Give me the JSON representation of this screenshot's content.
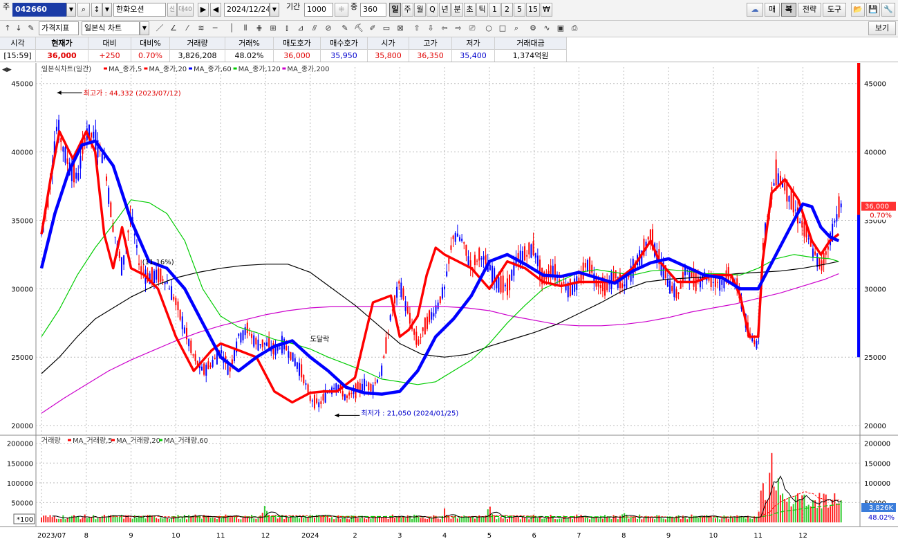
{
  "toolbar1": {
    "market_label": "주",
    "stock_code": "042660",
    "stock_name": "한화오션",
    "badge_credit": "신",
    "badge_margin": "대40",
    "date": "2024/12/24",
    "period_label": "기간",
    "period_value": "1000",
    "overlap_label": "중",
    "overlap_value": "360",
    "intervals": [
      "일",
      "주",
      "월",
      "Q",
      "년",
      "분",
      "초",
      "틱",
      "1",
      "2",
      "5",
      "15",
      "₩"
    ],
    "active_interval": "일",
    "right_buttons": [
      "매",
      "복",
      "전략",
      "도구"
    ]
  },
  "toolbar2": {
    "price_indicator": "가격지표",
    "chart_type": "일본식 차트",
    "view_button": "보기"
  },
  "quote": {
    "headers": [
      "시각",
      "현재가",
      "대비",
      "대비%",
      "거래량",
      "거래%",
      "매도호가",
      "매수호가",
      "시가",
      "고가",
      "저가",
      "거래대금"
    ],
    "values": [
      "[15:59]",
      "36,000",
      "+250",
      "0.70%",
      "3,826,208",
      "48.02%",
      "36,000",
      "35,950",
      "35,800",
      "36,350",
      "35,400",
      "1,374억원"
    ]
  },
  "chart_data": [
    {
      "type": "candlestick",
      "legend_title": "일본식차트(일간)",
      "legend": [
        {
          "name": "MA_종가,5",
          "color": "#ff0000"
        },
        {
          "name": "MA_종가,20",
          "color": "#ff0000"
        },
        {
          "name": "MA_종가,60",
          "color": "#0000ff"
        },
        {
          "name": "MA_종가,120",
          "color": "#00cc00"
        },
        {
          "name": "MA_종가,200",
          "color": "#cc00cc"
        }
      ],
      "y_ticks": [
        20000,
        25000,
        30000,
        35000,
        40000,
        45000
      ],
      "y_tick_labels": [
        "20000",
        "25000",
        "30000",
        "35000",
        "40000",
        "45000"
      ],
      "ylim": [
        19500,
        46200
      ],
      "x_ticks": [
        {
          "label": "2023/07",
          "month": 0
        },
        {
          "label": "8",
          "month": 1
        },
        {
          "label": "9",
          "month": 2
        },
        {
          "label": "10",
          "month": 3
        },
        {
          "label": "11",
          "month": 4
        },
        {
          "label": "12",
          "month": 5
        },
        {
          "label": "2024",
          "month": 6
        },
        {
          "label": "2",
          "month": 7
        },
        {
          "label": "3",
          "month": 8
        },
        {
          "label": "4",
          "month": 9
        },
        {
          "label": "5",
          "month": 10
        },
        {
          "label": "6",
          "month": 11
        },
        {
          "label": "7",
          "month": 12
        },
        {
          "label": "8",
          "month": 13
        },
        {
          "label": "9",
          "month": 14
        },
        {
          "label": "10",
          "month": 15
        },
        {
          "label": "11",
          "month": 16
        },
        {
          "label": "12",
          "month": 17
        }
      ],
      "max_annotation": "최고가 : 44,332 (2023/07/12)",
      "min_annotation": "최저가 : 21,050 (2024/01/25)",
      "mid_annotation_1": "(11.16%)",
      "mid_annotation_2": "도달락",
      "current_price_label": "36,000",
      "current_change_label": "0.70%",
      "close_series": {
        "month": [
          0.0,
          0.15,
          0.35,
          0.55,
          0.8,
          1.0,
          1.2,
          1.4,
          1.6,
          1.8,
          2.0,
          2.2,
          2.4,
          2.6,
          2.8,
          3.0,
          3.2,
          3.4,
          3.6,
          3.8,
          4.0,
          4.2,
          4.4,
          4.6,
          4.8,
          5.0,
          5.2,
          5.4,
          5.6,
          5.8,
          6.0,
          6.2,
          6.4,
          6.6,
          6.8,
          7.0,
          7.2,
          7.4,
          7.6,
          7.8,
          8.0,
          8.2,
          8.4,
          8.6,
          8.8,
          9.0,
          9.2,
          9.4,
          9.6,
          9.8,
          10.0,
          10.2,
          10.4,
          10.6,
          10.8,
          11.0,
          11.2,
          11.4,
          11.6,
          11.8,
          12.0,
          12.2,
          12.4,
          12.6,
          12.8,
          13.0,
          13.2,
          13.4,
          13.6,
          13.8,
          14.0,
          14.2,
          14.4,
          14.6,
          14.8,
          15.0,
          15.2,
          15.4,
          15.6,
          15.8,
          16.0,
          16.1,
          16.2,
          16.4,
          16.6,
          16.8,
          17.0,
          17.2,
          17.4,
          17.6,
          17.8
        ],
        "value": [
          34000,
          36500,
          42000,
          39500,
          38000,
          41500,
          41000,
          39500,
          34500,
          31500,
          35500,
          31500,
          30800,
          31000,
          30500,
          29000,
          27000,
          25000,
          24000,
          24500,
          25500,
          24000,
          26500,
          27000,
          26000,
          26000,
          25500,
          26000,
          25000,
          24000,
          22000,
          21500,
          22500,
          23000,
          22000,
          22500,
          23000,
          22800,
          24000,
          28000,
          30500,
          28000,
          26000,
          27500,
          28500,
          30000,
          34000,
          33500,
          31500,
          32500,
          31500,
          30500,
          30000,
          32000,
          32500,
          33000,
          30500,
          31500,
          30500,
          30000,
          30500,
          32000,
          30500,
          30000,
          31000,
          30000,
          31500,
          32500,
          34000,
          32000,
          30500,
          29500,
          31500,
          30500,
          31000,
          30500,
          30500,
          31000,
          29500,
          26500,
          26000,
          33000,
          35000,
          38500,
          37500,
          36000,
          34500,
          33000,
          31500,
          33500,
          36000
        ]
      },
      "ma5": {
        "month": [
          0.0,
          0.2,
          0.4,
          0.7,
          1.0,
          1.2,
          1.4,
          1.6,
          1.8,
          2.0,
          2.3,
          2.6,
          3.0,
          3.4,
          3.8,
          4.0,
          4.4,
          4.8,
          5.2,
          5.6,
          6.0,
          6.3,
          6.6,
          7.0,
          7.4,
          7.8,
          8.0,
          8.2,
          8.4,
          8.6,
          8.8,
          9.0,
          9.3,
          9.6,
          10.0,
          10.4,
          10.8,
          11.2,
          11.6,
          12.0,
          12.4,
          12.8,
          13.2,
          13.6,
          13.8,
          14.2,
          14.6,
          15.0,
          15.4,
          15.6,
          15.8,
          16.0,
          16.1,
          16.3,
          16.6,
          16.9,
          17.2,
          17.4,
          17.6,
          17.8
        ],
        "value": [
          34000,
          38000,
          41500,
          39500,
          41500,
          40000,
          34000,
          31500,
          34500,
          31500,
          31000,
          30000,
          26500,
          24000,
          25500,
          26000,
          25500,
          25000,
          22500,
          21700,
          22400,
          22500,
          22500,
          23500,
          29000,
          29500,
          26500,
          27000,
          28000,
          31000,
          33000,
          32500,
          32000,
          31500,
          30000,
          32000,
          31500,
          30500,
          30200,
          30500,
          30500,
          30500,
          31500,
          33500,
          32000,
          30500,
          30500,
          31000,
          31000,
          29500,
          26500,
          26500,
          32000,
          37000,
          38000,
          36500,
          33500,
          32500,
          33500,
          34000
        ]
      },
      "ma60": {
        "month": [
          0.0,
          0.3,
          0.6,
          0.9,
          1.2,
          1.6,
          2.0,
          2.4,
          2.8,
          3.2,
          3.6,
          4.0,
          4.4,
          4.8,
          5.2,
          5.6,
          6.0,
          6.4,
          6.8,
          7.2,
          7.6,
          8.0,
          8.4,
          8.8,
          9.2,
          9.6,
          10.0,
          10.4,
          10.8,
          11.2,
          11.6,
          12.0,
          12.4,
          12.8,
          13.2,
          13.6,
          14.0,
          14.4,
          14.8,
          15.2,
          15.6,
          16.0,
          16.4,
          16.8,
          17.0,
          17.2,
          17.4,
          17.6,
          17.8
        ],
        "value": [
          31500,
          35500,
          38500,
          40500,
          40800,
          39000,
          35000,
          32000,
          31500,
          30000,
          27500,
          25000,
          24000,
          25000,
          25800,
          26200,
          25000,
          24000,
          22800,
          22400,
          22300,
          22500,
          24000,
          26500,
          27800,
          29500,
          32000,
          32500,
          31800,
          31000,
          30900,
          31200,
          30800,
          30400,
          31300,
          31900,
          32200,
          31600,
          31000,
          30800,
          30000,
          30000,
          32500,
          35000,
          36200,
          36000,
          34500,
          33800,
          33500
        ]
      },
      "ma120": {
        "month": [
          0.0,
          0.4,
          0.8,
          1.2,
          1.6,
          2.0,
          2.4,
          2.8,
          3.2,
          3.6,
          4.0,
          4.4,
          4.8,
          5.2,
          5.6,
          6.0,
          6.4,
          6.8,
          7.2,
          7.6,
          8.0,
          8.4,
          8.8,
          9.2,
          9.6,
          10.0,
          10.4,
          10.8,
          11.2,
          11.6,
          12.0,
          12.4,
          12.8,
          13.2,
          13.6,
          14.0,
          14.4,
          14.8,
          15.2,
          15.6,
          16.0,
          16.4,
          16.8,
          17.2,
          17.6,
          17.8
        ],
        "value": [
          26500,
          28500,
          31000,
          33000,
          34700,
          36500,
          36300,
          35500,
          33500,
          30000,
          28000,
          27200,
          26800,
          26300,
          26000,
          25600,
          25000,
          24500,
          24000,
          23400,
          23200,
          23000,
          23200,
          24000,
          24800,
          26000,
          27500,
          28800,
          30000,
          30600,
          31200,
          31400,
          31200,
          31000,
          31300,
          31400,
          31300,
          31100,
          31100,
          31000,
          31500,
          32200,
          32500,
          32300,
          32200,
          32000
        ]
      },
      "ma200": {
        "month": [
          0.0,
          0.4,
          0.8,
          1.2,
          1.6,
          2.0,
          2.5,
          3.0,
          3.5,
          4.0,
          4.5,
          5.0,
          5.5,
          6.0,
          6.5,
          7.0,
          7.5,
          8.0,
          8.5,
          9.0,
          9.5,
          10.0,
          10.5,
          11.0,
          11.5,
          12.0,
          12.5,
          13.0,
          13.5,
          14.0,
          14.5,
          15.0,
          15.5,
          16.0,
          16.5,
          17.0,
          17.5,
          17.8
        ],
        "value": [
          23800,
          25000,
          26500,
          27800,
          28600,
          29400,
          30200,
          30800,
          31200,
          31500,
          31700,
          31800,
          31800,
          31200,
          30000,
          28800,
          27400,
          26000,
          25200,
          25000,
          25200,
          25800,
          26300,
          26800,
          27400,
          28200,
          29000,
          29900,
          30500,
          30700,
          30800,
          30900,
          31100,
          31200,
          31300,
          31500,
          31800,
          32000
        ]
      },
      "ma_magenta": {
        "month": [
          0.0,
          0.5,
          1.0,
          1.5,
          2.0,
          2.5,
          3.0,
          3.5,
          4.0,
          4.5,
          5.0,
          5.5,
          6.0,
          6.5,
          7.0,
          7.5,
          8.0,
          8.5,
          9.0,
          9.5,
          10.0,
          10.5,
          11.0,
          11.5,
          12.0,
          12.5,
          13.0,
          13.5,
          14.0,
          14.5,
          15.0,
          15.5,
          16.0,
          16.5,
          17.0,
          17.5,
          17.8
        ],
        "value": [
          20900,
          22000,
          23000,
          24000,
          24800,
          25500,
          26200,
          26800,
          27300,
          27700,
          28100,
          28400,
          28600,
          28700,
          28700,
          28700,
          28700,
          28700,
          28700,
          28600,
          28400,
          28000,
          27700,
          27400,
          27300,
          27300,
          27400,
          27600,
          27900,
          28300,
          28600,
          28900,
          29300,
          29700,
          30200,
          30700,
          31100
        ]
      },
      "volume": {
        "legend_title": "거래량",
        "legend": [
          {
            "name": "MA_거래량,5",
            "color": "#000000"
          },
          {
            "name": "MA_거래량,20",
            "color": "#ff0000"
          },
          {
            "name": "MA_거래량,60",
            "color": "#00cc00"
          }
        ],
        "y_ticks": [
          50000,
          100000,
          150000,
          200000
        ],
        "y_tick_labels": [
          "50000",
          "100000",
          "150000",
          "200000"
        ],
        "ylim": [
          0,
          210000
        ],
        "scale_note": "*100",
        "current_volume_label": "3,826K",
        "current_ratio_label": "48.02%",
        "spikes": [
          {
            "month": 5.0,
            "value": 62000
          },
          {
            "month": 9.0,
            "value": 45000
          },
          {
            "month": 10.0,
            "value": 50000
          },
          {
            "month": 13.0,
            "value": 40000
          },
          {
            "month": 16.1,
            "value": 118000
          },
          {
            "month": 16.3,
            "value": 200000
          },
          {
            "month": 16.45,
            "value": 150000
          },
          {
            "month": 16.8,
            "value": 70000
          },
          {
            "month": 17.8,
            "value": 78000
          }
        ]
      }
    }
  ]
}
